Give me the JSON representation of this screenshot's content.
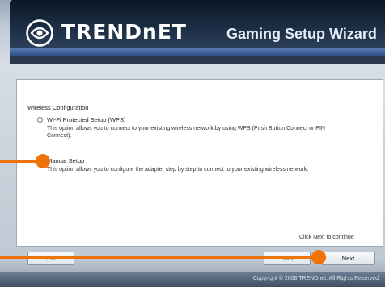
{
  "header": {
    "brand": "TRENDnET",
    "wizard_title": "Gaming Setup Wizard"
  },
  "panel": {
    "section_label": "Wireless Configuration",
    "options": [
      {
        "label": "Wi-Fi Protected Setup (WPS)",
        "description": "This option allows you to connect to your existing wireless network by using WPS (Push Button Connect or PIN Connect).",
        "selected": false
      },
      {
        "label": "Manual Setup",
        "description": "This option allows you to configure the adapter step by step to connect to your existing wireless network.",
        "selected": true
      }
    ],
    "hint": "Click Next to continue"
  },
  "buttons": {
    "exit": "Exit",
    "back": "Back",
    "next": "Next"
  },
  "footer": {
    "copyright": "Copyright © 2008 TRENDnet. All Rights Reserved."
  },
  "colors": {
    "pointer": "#f0730a",
    "header_bg": "#1d2f46"
  }
}
